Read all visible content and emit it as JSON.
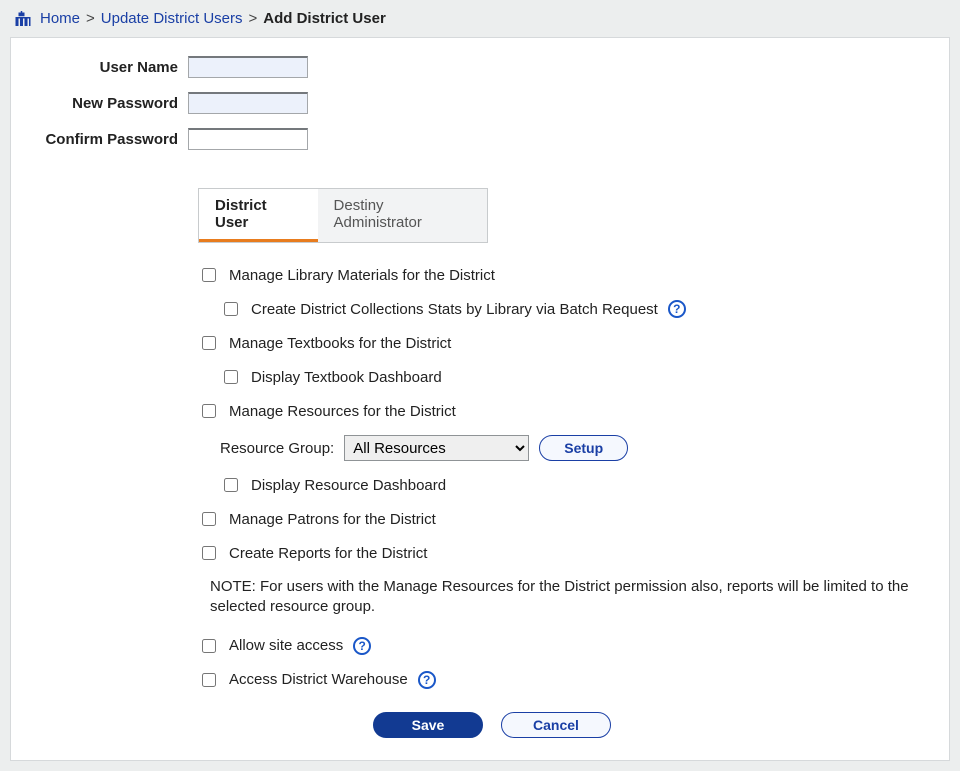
{
  "breadcrumb": {
    "home": "Home",
    "level2": "Update District Users",
    "current": "Add District User"
  },
  "form": {
    "username_label": "User Name",
    "username_value": "",
    "newpassword_label": "New Password",
    "newpassword_value": "",
    "confirmpassword_label": "Confirm Password",
    "confirmpassword_value": ""
  },
  "tabs": {
    "district_user": "District User",
    "destiny_admin": "Destiny Administrator"
  },
  "options": {
    "manage_library": "Manage Library Materials for the District",
    "create_collections_stats": "Create District Collections Stats by Library via Batch Request",
    "manage_textbooks": "Manage Textbooks for the District",
    "display_textbook_dashboard": "Display Textbook Dashboard",
    "manage_resources": "Manage Resources for the District",
    "resource_group_label": "Resource Group:",
    "resource_group_value": "All Resources",
    "setup_button": "Setup",
    "display_resource_dashboard": "Display Resource Dashboard",
    "manage_patrons": "Manage Patrons for the District",
    "create_reports": "Create Reports for the District",
    "note": "NOTE: For users with the Manage Resources for the District permission also, reports will be limited to the selected resource group.",
    "allow_site_access": "Allow site access",
    "access_warehouse": "Access District Warehouse"
  },
  "actions": {
    "save": "Save",
    "cancel": "Cancel"
  }
}
